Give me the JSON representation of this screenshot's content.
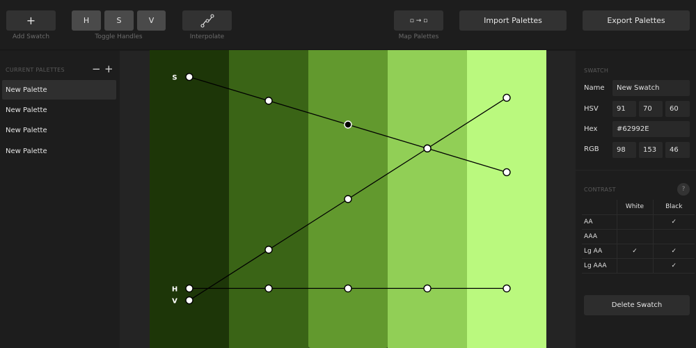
{
  "toolbar": {
    "add_swatch": {
      "glyph": "+",
      "label": "Add Swatch"
    },
    "toggle_handles": {
      "buttons": [
        "H",
        "S",
        "V"
      ],
      "label": "Toggle Handles"
    },
    "interpolate": {
      "label": "Interpolate",
      "icon": "curve-nodes-icon"
    },
    "map_palettes": {
      "glyph": "▫ → ▫",
      "label": "Map Palettes"
    },
    "import_label": "Import Palettes",
    "export_label": "Export Palettes"
  },
  "sidebar": {
    "heading": "CURRENT PALETTES",
    "remove_glyph": "−",
    "add_glyph": "+",
    "palettes": [
      "New Palette",
      "New Palette",
      "New Palette",
      "New Palette"
    ]
  },
  "editor": {
    "swatch_colors": [
      "#1d3608",
      "#3a6416",
      "#62992e",
      "#91cf56",
      "#baf97e"
    ],
    "selected_index": 2,
    "handle_labels": {
      "s": "S",
      "h": "H",
      "v": "V"
    },
    "curves": {
      "s": [
        0.91,
        0.83,
        0.75,
        0.67,
        0.59
      ],
      "h": [
        0.2,
        0.2,
        0.2,
        0.2,
        0.2
      ],
      "v": [
        0.16,
        0.33,
        0.5,
        0.67,
        0.84
      ]
    }
  },
  "swatch": {
    "heading": "SWATCH",
    "name_label": "Name",
    "name_value": "New Swatch",
    "hsv_label": "HSV",
    "hsv": [
      "91",
      "70",
      "60"
    ],
    "hex_label": "Hex",
    "hex": "#62992E",
    "rgb_label": "RGB",
    "rgb": [
      "98",
      "153",
      "46"
    ]
  },
  "contrast": {
    "heading": "CONTRAST",
    "help": "?",
    "columns": [
      "White",
      "Black"
    ],
    "rows": [
      {
        "label": "AA",
        "white": "",
        "black": "✓"
      },
      {
        "label": "AAA",
        "white": "",
        "black": ""
      },
      {
        "label": "Lg AA",
        "white": "✓",
        "black": "✓"
      },
      {
        "label": "Lg AAA",
        "white": "",
        "black": "✓"
      }
    ]
  },
  "delete_label": "Delete Swatch"
}
